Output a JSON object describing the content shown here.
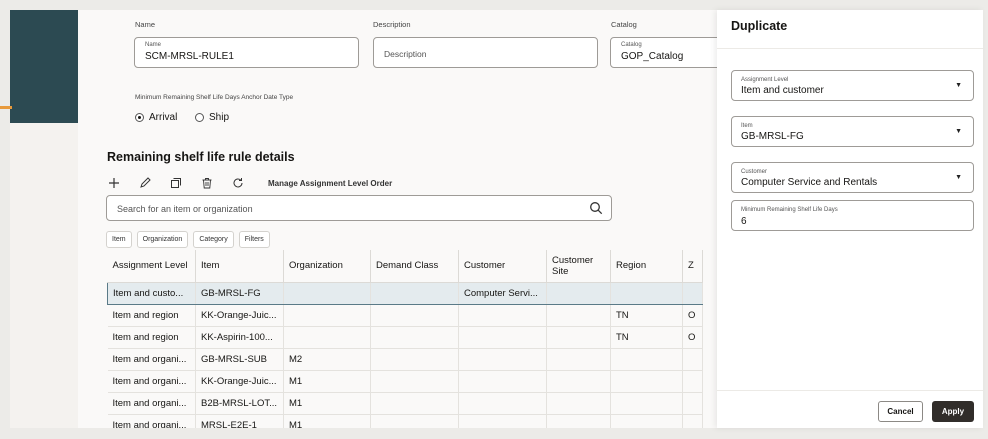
{
  "form": {
    "name_label": "Name",
    "description_label": "Description",
    "catalog_label": "Catalog",
    "name_field_label": "Name",
    "name_value": "SCM-MRSL-RULE1",
    "description_placeholder": "Description",
    "catalog_field_label": "Catalog",
    "catalog_value": "GOP_Catalog",
    "anchor_label": "Minimum Remaining Shelf Life Days Anchor Date Type",
    "radio_arrival": "Arrival",
    "radio_ship": "Ship",
    "selected_radio": "Arrival"
  },
  "details": {
    "title": "Remaining shelf life rule details",
    "manage_link": "Manage Assignment Level Order",
    "search_placeholder": "Search for an item or organization",
    "chips": [
      "Item",
      "Organization",
      "Category",
      "Filters"
    ],
    "icons": [
      "add-icon",
      "edit-icon",
      "duplicate-icon",
      "delete-icon",
      "refresh-icon"
    ],
    "columns": [
      "Assignment Level",
      "Item",
      "Organization",
      "Demand Class",
      "Customer",
      "Customer Site",
      "Region",
      "Z"
    ],
    "rows": [
      [
        "Item and custo...",
        "GB-MRSL-FG",
        "",
        "",
        "Computer Servi...",
        "",
        "",
        ""
      ],
      [
        "Item and region",
        "KK-Orange-Juic...",
        "",
        "",
        "",
        "",
        "TN",
        "O"
      ],
      [
        "Item and region",
        "KK-Aspirin-100...",
        "",
        "",
        "",
        "",
        "TN",
        "O"
      ],
      [
        "Item and organi...",
        "GB-MRSL-SUB",
        "M2",
        "",
        "",
        "",
        "",
        ""
      ],
      [
        "Item and organi...",
        "KK-Orange-Juic...",
        "M1",
        "",
        "",
        "",
        "",
        ""
      ],
      [
        "Item and organi...",
        "B2B-MRSL-LOT...",
        "M1",
        "",
        "",
        "",
        "",
        ""
      ],
      [
        "Item and organi...",
        "MRSL-E2E-1",
        "M1",
        "",
        "",
        "",
        "",
        ""
      ]
    ]
  },
  "panel": {
    "title": "Duplicate",
    "assignment_label": "Assignment Level",
    "assignment_value": "Item and customer",
    "item_label": "Item",
    "item_value": "GB-MRSL-FG",
    "customer_label": "Customer",
    "customer_value": "Computer Service and Rentals",
    "min_days_label": "Minimum Remaining Shelf Life Days",
    "min_days_value": "6",
    "cancel_label": "Cancel",
    "apply_label": "Apply"
  }
}
